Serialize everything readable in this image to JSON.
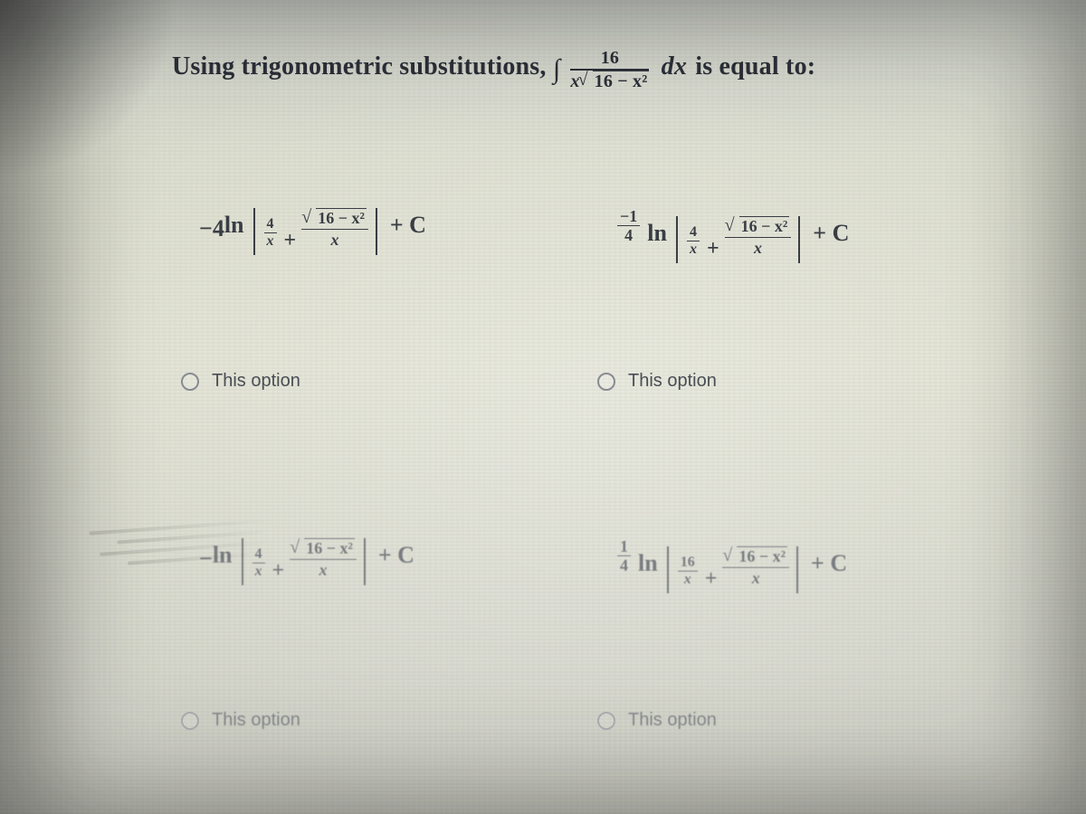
{
  "question": {
    "lead": "Using trigonometric substitutions,",
    "integrand_num": "16",
    "integrand_den_x": "x",
    "integrand_den_rad": "16 − x²",
    "dx": "dx",
    "tail": "is equal to:"
  },
  "options": [
    {
      "coef": "−4",
      "ln": "ln",
      "abs_first_num": "4",
      "abs_first_den": "x",
      "abs_rad": "16 − x²",
      "abs_den": "x",
      "plusC": "+ C",
      "label": "This option",
      "faded": false
    },
    {
      "coef_num": "−1",
      "coef_den": "4",
      "ln": "ln",
      "abs_first_num": "4",
      "abs_first_den": "x",
      "abs_rad": "16 − x²",
      "abs_den": "x",
      "plusC": "+ C",
      "label": "This option",
      "faded": false
    },
    {
      "coef": "−",
      "ln": "ln",
      "abs_first_num": "4",
      "abs_first_den": "x",
      "abs_rad": "16 − x²",
      "abs_den": "x",
      "plusC": "+ C",
      "label": "This option",
      "faded": true
    },
    {
      "coef_num": "1",
      "coef_den": "4",
      "ln": "ln",
      "abs_first_num": "16",
      "abs_first_den": "x",
      "abs_rad": "16 − x²",
      "abs_den": "x",
      "plusC": "+ C",
      "label": "This option",
      "faded": true
    }
  ]
}
